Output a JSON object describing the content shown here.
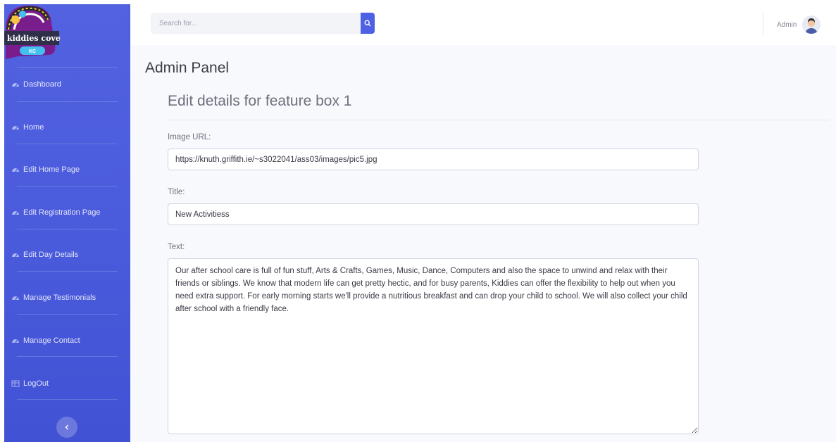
{
  "brand": {
    "logo_text": "kiddies cove",
    "badge_text": "KC"
  },
  "sidebar": {
    "items": [
      {
        "label": "Dashboard",
        "icon": "dashboard-icon"
      },
      {
        "label": "Home",
        "icon": "dashboard-icon"
      },
      {
        "label": "Edit Home Page",
        "icon": "dashboard-icon"
      },
      {
        "label": "Edit Registration Page",
        "icon": "dashboard-icon"
      },
      {
        "label": "Edit Day Details",
        "icon": "dashboard-icon"
      },
      {
        "label": "Manage Testimonials",
        "icon": "dashboard-icon"
      },
      {
        "label": "Manage Contact",
        "icon": "dashboard-icon"
      },
      {
        "label": "LogOut",
        "icon": "table-icon"
      }
    ],
    "toggle_icon": "chevron-left-icon"
  },
  "topbar": {
    "search_placeholder": "Search for...",
    "search_icon": "search-icon",
    "user_name": "Admin"
  },
  "main": {
    "page_title": "Admin Panel",
    "form_title": "Edit details for feature box 1",
    "image_url_label": "Image URL:",
    "image_url_value": "https://knuth.griffith.ie/~s3022041/ass03/images/pic5.jpg",
    "title_label": "Title:",
    "title_value": "New Activitiess",
    "text_label": "Text:",
    "text_value": "Our after school care is full of fun stuff, Arts & Crafts, Games, Music, Dance, Computers and also the space to unwind and relax with their friends or siblings. We know that modern life can get pretty hectic, and for busy parents, Kiddies can offer the flexibility to help out when you need extra support. For early morning starts we'll provide a nutritious breakfast and can drop your child to school. We will also collect your child after school with a friendly face."
  },
  "colors": {
    "sidebar_bg": "#4e5fe0",
    "accent": "#4e60e3",
    "content_bg": "#f8f9fc",
    "text_muted": "#6e707e"
  }
}
